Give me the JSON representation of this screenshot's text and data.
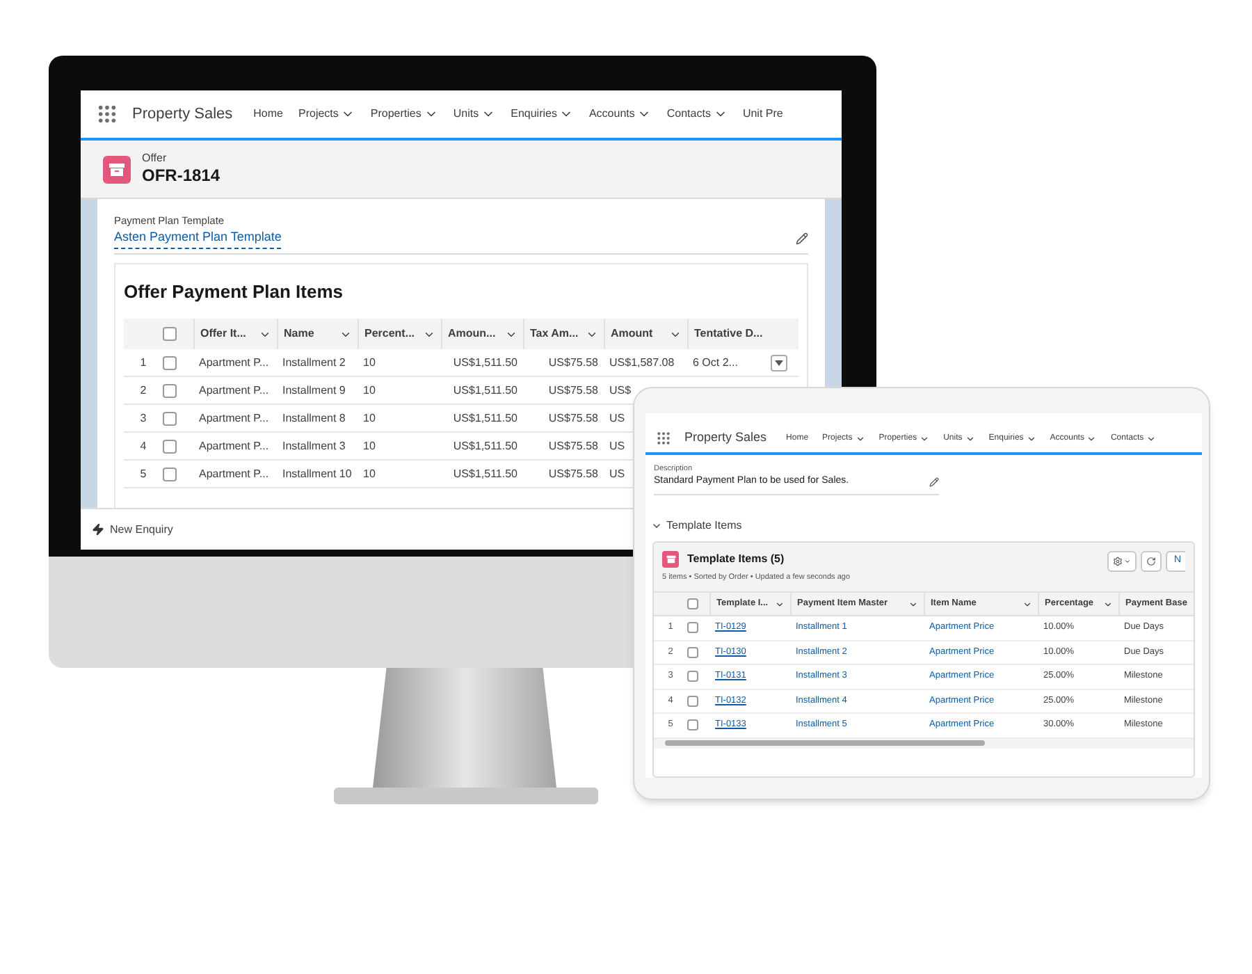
{
  "monitor": {
    "app_name": "Property Sales",
    "nav": [
      {
        "label": "Home",
        "menu": false
      },
      {
        "label": "Projects",
        "menu": true
      },
      {
        "label": "Properties",
        "menu": true
      },
      {
        "label": "Units",
        "menu": true
      },
      {
        "label": "Enquiries",
        "menu": true
      },
      {
        "label": "Accounts",
        "menu": true
      },
      {
        "label": "Contacts",
        "menu": true
      },
      {
        "label": "Unit Pre",
        "menu": false
      }
    ],
    "record": {
      "type": "Offer",
      "name": "OFR-1814"
    },
    "field": {
      "label": "Payment Plan Template",
      "value": "Asten Payment Plan Template"
    },
    "section_title": "Offer Payment Plan Items",
    "table": {
      "all_checked": false,
      "columns": [
        {
          "label": "Offer It...",
          "menu": true
        },
        {
          "label": "Name",
          "menu": true
        },
        {
          "label": "Percent...",
          "menu": true
        },
        {
          "label": "Amoun...",
          "menu": true
        },
        {
          "label": "Tax Am...",
          "menu": true
        },
        {
          "label": "Amount",
          "menu": true
        },
        {
          "label": "Tentative D...",
          "menu": false
        }
      ],
      "rows": [
        {
          "number": "1",
          "checked": false,
          "row_menu": true,
          "cells": [
            "Apartment P...",
            "Installment 2",
            "10",
            "US$1,511.50",
            "US$75.58",
            "US$1,587.08",
            "6 Oct 2..."
          ]
        },
        {
          "number": "2",
          "checked": false,
          "cells": [
            "Apartment P...",
            "Installment 9",
            "10",
            "US$1,511.50",
            "US$75.58",
            "US$"
          ]
        },
        {
          "number": "3",
          "checked": false,
          "cells": [
            "Apartment P...",
            "Installment 8",
            "10",
            "US$1,511.50",
            "US$75.58",
            "US"
          ]
        },
        {
          "number": "4",
          "checked": false,
          "cells": [
            "Apartment P...",
            "Installment 3",
            "10",
            "US$1,511.50",
            "US$75.58",
            "US"
          ]
        },
        {
          "number": "5",
          "checked": false,
          "cells": [
            "Apartment P...",
            "Installment 10",
            "10",
            "US$1,511.50",
            "US$75.58",
            "US"
          ]
        }
      ]
    },
    "utility": "New Enquiry"
  },
  "tablet": {
    "app_name": "Property Sales",
    "nav": [
      {
        "label": "Home",
        "menu": false
      },
      {
        "label": "Projects",
        "menu": true
      },
      {
        "label": "Properties",
        "menu": true
      },
      {
        "label": "Units",
        "menu": true
      },
      {
        "label": "Enquiries",
        "menu": true
      },
      {
        "label": "Accounts",
        "menu": true
      },
      {
        "label": "Contacts",
        "menu": true
      }
    ],
    "field": {
      "label": "Description",
      "value": "Standard Payment Plan to be used for Sales."
    },
    "section": {
      "title": "Template Items",
      "expanded": true
    },
    "card": {
      "title": "Template Items (5)",
      "subtitle": "5 items • Sorted by Order • Updated a few seconds ago",
      "new_button": "N"
    },
    "table": {
      "all_checked": false,
      "columns": [
        {
          "label": "Template I...",
          "menu": true
        },
        {
          "label": "Payment Item Master",
          "menu": true
        },
        {
          "label": "Item Name",
          "menu": true
        },
        {
          "label": "Percentage",
          "menu": true
        },
        {
          "label": "Payment Base",
          "menu": false
        }
      ],
      "rows": [
        {
          "number": "1",
          "checked": false,
          "cells": [
            {
              "text": "TI-0129",
              "kind": "link"
            },
            {
              "text": "Installment 1",
              "kind": "ref"
            },
            {
              "text": "Apartment Price",
              "kind": "ref"
            },
            {
              "text": "10.00%",
              "kind": "plain"
            },
            {
              "text": "Due Days",
              "kind": "plain"
            }
          ]
        },
        {
          "number": "2",
          "checked": false,
          "cells": [
            {
              "text": "TI-0130",
              "kind": "link"
            },
            {
              "text": "Installment 2",
              "kind": "ref"
            },
            {
              "text": "Apartment Price",
              "kind": "ref"
            },
            {
              "text": "10.00%",
              "kind": "plain"
            },
            {
              "text": "Due Days",
              "kind": "plain"
            }
          ]
        },
        {
          "number": "3",
          "checked": false,
          "cells": [
            {
              "text": "TI-0131",
              "kind": "link"
            },
            {
              "text": "Installment 3",
              "kind": "ref"
            },
            {
              "text": "Apartment Price",
              "kind": "ref"
            },
            {
              "text": "25.00%",
              "kind": "plain"
            },
            {
              "text": "Milestone",
              "kind": "plain"
            }
          ]
        },
        {
          "number": "4",
          "checked": false,
          "cells": [
            {
              "text": "TI-0132",
              "kind": "link"
            },
            {
              "text": "Installment 4",
              "kind": "ref"
            },
            {
              "text": "Apartment Price",
              "kind": "ref"
            },
            {
              "text": "25.00%",
              "kind": "plain"
            },
            {
              "text": "Milestone",
              "kind": "plain"
            }
          ]
        },
        {
          "number": "5",
          "checked": false,
          "cells": [
            {
              "text": "TI-0133",
              "kind": "link"
            },
            {
              "text": "Installment 5",
              "kind": "ref"
            },
            {
              "text": "Apartment Price",
              "kind": "ref"
            },
            {
              "text": "30.00%",
              "kind": "plain"
            },
            {
              "text": "Milestone",
              "kind": "plain"
            }
          ]
        }
      ]
    }
  }
}
